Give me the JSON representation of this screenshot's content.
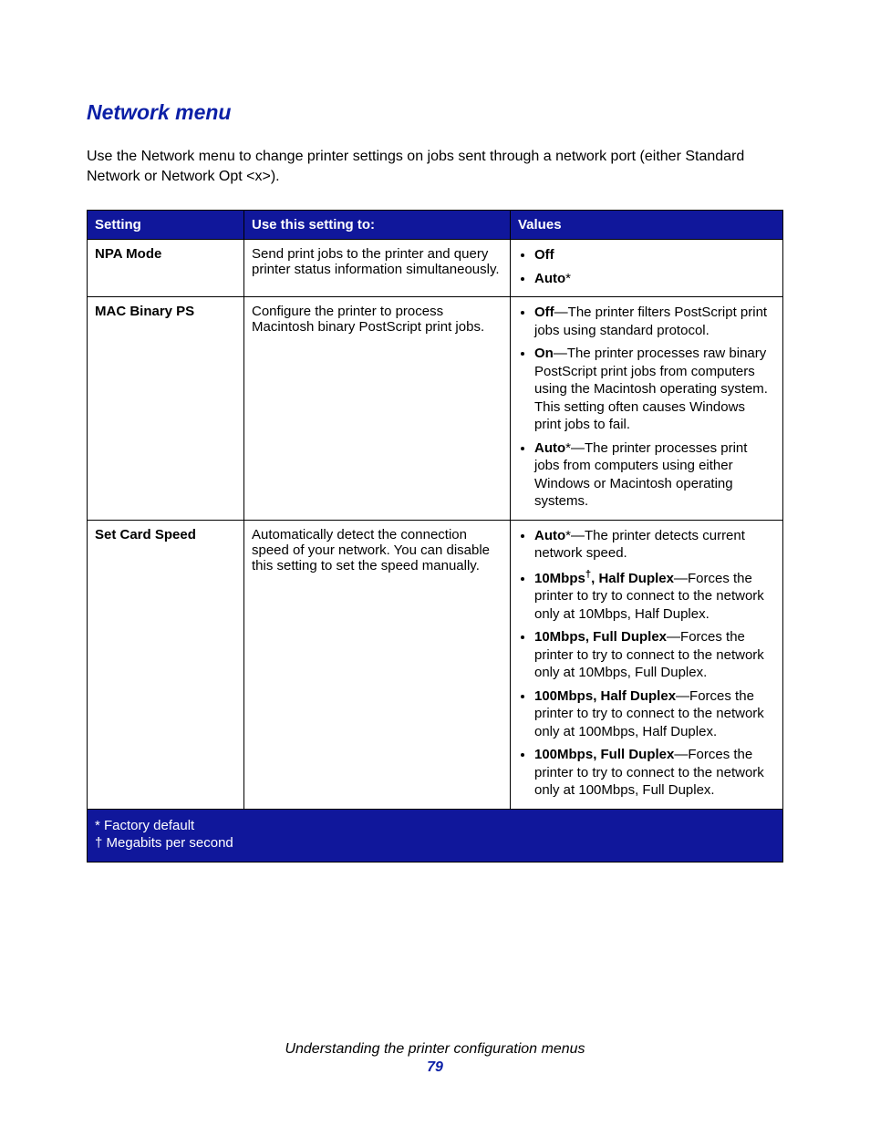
{
  "heading": "Network menu",
  "intro": "Use the Network menu to change printer settings on jobs sent through a network port (either Standard Network or Network Opt <x>).",
  "table": {
    "headers": {
      "setting": "Setting",
      "use": "Use this setting to:",
      "values": "Values"
    },
    "rows": {
      "npa": {
        "setting": "NPA Mode",
        "use": "Send print jobs to the printer and query printer status information simultaneously.",
        "values": {
          "off": "Off",
          "auto": "Auto",
          "auto_mark": "*"
        }
      },
      "mac": {
        "setting": "MAC Binary PS",
        "use": "Configure the printer to process Macintosh binary PostScript print jobs.",
        "values": {
          "off_b": "Off",
          "off_t": "—The printer filters PostScript print jobs using standard protocol.",
          "on_b": "On",
          "on_t": "—The printer processes raw binary PostScript print jobs from computers using the Macintosh operating system. This setting often causes Windows print jobs to fail.",
          "auto_b": "Auto",
          "auto_mark": "*",
          "auto_t": "—The printer processes print jobs from computers using either Windows or Macintosh operating systems."
        }
      },
      "speed": {
        "setting": "Set Card Speed",
        "use": "Automatically detect the connection speed of your network. You can disable this setting to set the speed manually.",
        "values": {
          "auto_b": "Auto",
          "auto_mark": "*",
          "auto_t": "—The printer detects current network speed.",
          "v10h_b1": "10Mbps",
          "v10h_sup": "†",
          "v10h_b2": ", Half Duplex",
          "v10h_t": "—Forces the printer to try to connect to the network only at 10Mbps, Half Duplex.",
          "v10f_b": "10Mbps, Full Duplex",
          "v10f_t": "—Forces the printer to try to connect to the network only at 10Mbps, Full Duplex.",
          "v100h_b": "100Mbps, Half Duplex",
          "v100h_t": "—Forces the printer to try to connect to the network only at 100Mbps, Half Duplex.",
          "v100f_b": "100Mbps, Full Duplex",
          "v100f_t": "—Forces the printer to try to connect to the network only at 100Mbps, Full Duplex."
        }
      }
    },
    "footnotes": {
      "default": "* Factory default",
      "mbps": "† Megabits per second"
    }
  },
  "footer": {
    "chapter": "Understanding the printer configuration menus",
    "page": "79"
  }
}
